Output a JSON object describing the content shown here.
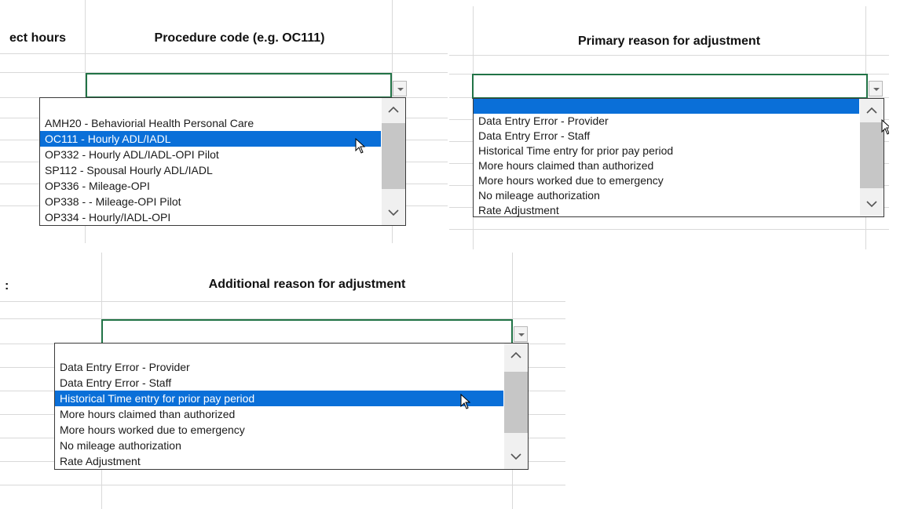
{
  "panel1": {
    "cut_header": "ect hours",
    "header": "Procedure code (e.g. OC111)",
    "items": [
      "AMH20 - Behaviorial Health Personal Care",
      "OC111 - Hourly ADL/IADL",
      "OP332 - Hourly ADL/IADL-OPI Pilot",
      "SP112 - Spousal Hourly ADL/IADL",
      "OP336 - Mileage-OPI",
      "OP338 - - Mileage-OPI Pilot",
      "OP334 - Hourly/IADL-OPI"
    ],
    "selected_index": 1
  },
  "panel2": {
    "header": "Primary reason for adjustment",
    "items": [
      "",
      "Data Entry Error - Provider",
      "Data Entry Error - Staff",
      "Historical Time entry for prior pay period",
      "More hours claimed than authorized",
      "More hours worked due to emergency",
      "No mileage authorization",
      "Rate Adjustment"
    ],
    "selected_index": 0
  },
  "panel3": {
    "cut_header": ":",
    "header": "Additional reason for adjustment",
    "items": [
      "Data Entry Error - Provider",
      "Data Entry Error - Staff",
      "Historical Time entry for prior pay period",
      "More hours claimed than authorized",
      "More hours worked due to emergency",
      "No mileage authorization",
      "Rate Adjustment"
    ],
    "selected_index": 2
  },
  "colors": {
    "selection": "#0a6fd8",
    "cell_border": "#217346",
    "gridline": "#d9d9d9"
  }
}
